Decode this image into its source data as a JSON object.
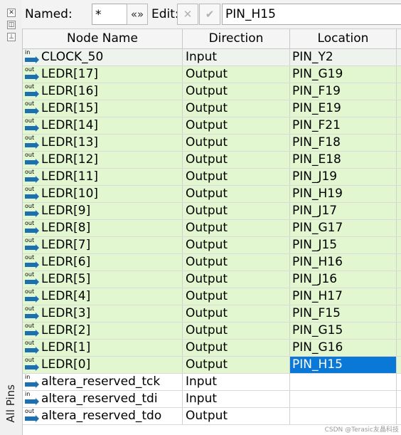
{
  "dock": {
    "title": "All Pins"
  },
  "toolbar": {
    "named_label": "Named:",
    "named_value": "*",
    "edit_label": "Edit:",
    "edit_value": "PIN_H15"
  },
  "table": {
    "columns": [
      "Node Name",
      "Direction",
      "Location"
    ],
    "rows": [
      {
        "icon": "in",
        "name": "CLOCK_50",
        "direction": "Input",
        "location": "PIN_Y2",
        "style": "first"
      },
      {
        "icon": "out",
        "name": "LEDR[17]",
        "direction": "Output",
        "location": "PIN_G19",
        "style": "green"
      },
      {
        "icon": "out",
        "name": "LEDR[16]",
        "direction": "Output",
        "location": "PIN_F19",
        "style": "green"
      },
      {
        "icon": "out",
        "name": "LEDR[15]",
        "direction": "Output",
        "location": "PIN_E19",
        "style": "green"
      },
      {
        "icon": "out",
        "name": "LEDR[14]",
        "direction": "Output",
        "location": "PIN_F21",
        "style": "green"
      },
      {
        "icon": "out",
        "name": "LEDR[13]",
        "direction": "Output",
        "location": "PIN_F18",
        "style": "green"
      },
      {
        "icon": "out",
        "name": "LEDR[12]",
        "direction": "Output",
        "location": "PIN_E18",
        "style": "green"
      },
      {
        "icon": "out",
        "name": "LEDR[11]",
        "direction": "Output",
        "location": "PIN_J19",
        "style": "green"
      },
      {
        "icon": "out",
        "name": "LEDR[10]",
        "direction": "Output",
        "location": "PIN_H19",
        "style": "green"
      },
      {
        "icon": "out",
        "name": "LEDR[9]",
        "direction": "Output",
        "location": "PIN_J17",
        "style": "green"
      },
      {
        "icon": "out",
        "name": "LEDR[8]",
        "direction": "Output",
        "location": "PIN_G17",
        "style": "green"
      },
      {
        "icon": "out",
        "name": "LEDR[7]",
        "direction": "Output",
        "location": "PIN_J15",
        "style": "green"
      },
      {
        "icon": "out",
        "name": "LEDR[6]",
        "direction": "Output",
        "location": "PIN_H16",
        "style": "green"
      },
      {
        "icon": "out",
        "name": "LEDR[5]",
        "direction": "Output",
        "location": "PIN_J16",
        "style": "green"
      },
      {
        "icon": "out",
        "name": "LEDR[4]",
        "direction": "Output",
        "location": "PIN_H17",
        "style": "green"
      },
      {
        "icon": "out",
        "name": "LEDR[3]",
        "direction": "Output",
        "location": "PIN_F15",
        "style": "green"
      },
      {
        "icon": "out",
        "name": "LEDR[2]",
        "direction": "Output",
        "location": "PIN_G15",
        "style": "green"
      },
      {
        "icon": "out",
        "name": "LEDR[1]",
        "direction": "Output",
        "location": "PIN_G16",
        "style": "green"
      },
      {
        "icon": "out",
        "name": "LEDR[0]",
        "direction": "Output",
        "location": "PIN_H15",
        "style": "green",
        "selected": true
      },
      {
        "icon": "in",
        "name": "altera_reserved_tck",
        "direction": "Input",
        "location": "",
        "style": "white"
      },
      {
        "icon": "in",
        "name": "altera_reserved_tdi",
        "direction": "Input",
        "location": "",
        "style": "white"
      },
      {
        "icon": "out",
        "name": "altera_reserved_tdo",
        "direction": "Output",
        "location": "",
        "style": "white"
      }
    ]
  },
  "watermark": "CSDN @Terasic友晶科技",
  "colors": {
    "assigned_row": "#e2f7cf",
    "selection": "#0a78d7"
  }
}
